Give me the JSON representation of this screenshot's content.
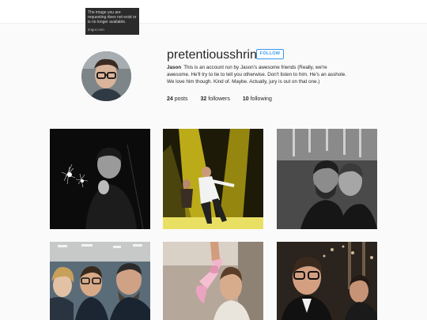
{
  "imgur_placeholder": {
    "message": "The image you are requesting does not exist or is no longer available.",
    "source": "imgur.com"
  },
  "profile": {
    "username": "pretentiousshrink",
    "follow_label": "FOLLOW",
    "display_name": "Jason",
    "bio": "This is an account run by Jason's awesome friends (Really, we're awesome. He'll try to lie to tell you otherwise. Don't listen to him. He's an asshole. We love him though. Kind of. Maybe. Actually, jury is out on that one.)",
    "stats": {
      "posts_count": "24",
      "posts_label": "posts",
      "followers_count": "32",
      "followers_label": "followers",
      "following_count": "10",
      "following_label": "following"
    }
  },
  "colors": {
    "accent": "#3897f0",
    "background": "#fafafa"
  },
  "posts": [
    {
      "subject": "man-with-sparkler-bw"
    },
    {
      "subject": "concert-stage-yellow-lights"
    },
    {
      "subject": "two-men-selfie-bw"
    },
    {
      "subject": "group-selfie-three-people"
    },
    {
      "subject": "man-with-pink-bow"
    },
    {
      "subject": "party-selfie-night"
    }
  ]
}
